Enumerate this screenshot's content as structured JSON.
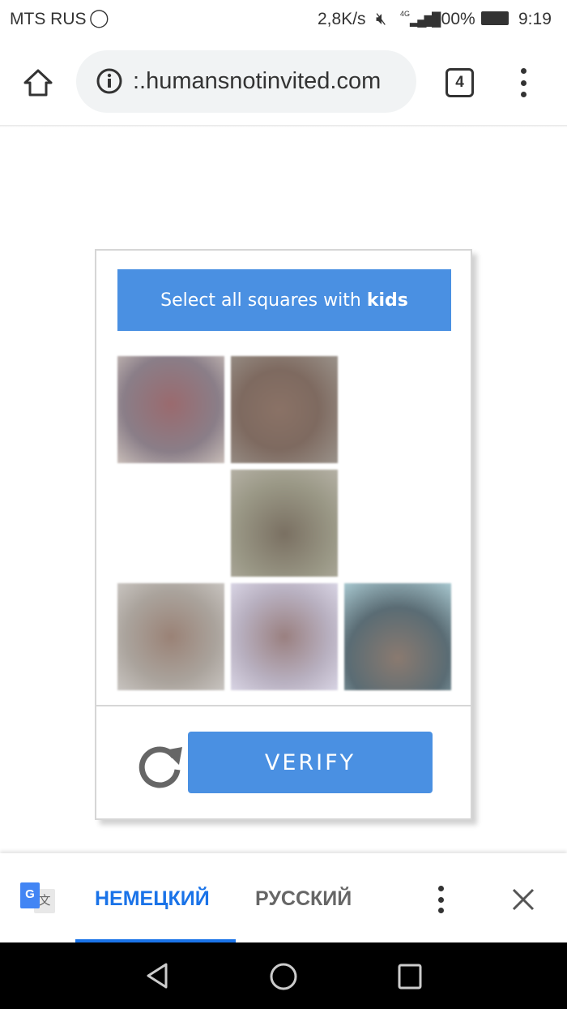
{
  "status_bar": {
    "carrier": "MTS RUS",
    "speed": "2,8K/s",
    "network": "4G",
    "battery": "100%",
    "time": "9:19"
  },
  "browser": {
    "url": ":.humansnotinvited.com",
    "tab_count": "4"
  },
  "captcha": {
    "instruction_prefix": "Select all squares with ",
    "instruction_target": "kids",
    "tiles": [
      {
        "row": 0,
        "col": 0,
        "visible": true
      },
      {
        "row": 0,
        "col": 1,
        "visible": true
      },
      {
        "row": 0,
        "col": 2,
        "visible": false
      },
      {
        "row": 1,
        "col": 0,
        "visible": false
      },
      {
        "row": 1,
        "col": 1,
        "visible": true
      },
      {
        "row": 1,
        "col": 2,
        "visible": false
      },
      {
        "row": 2,
        "col": 0,
        "visible": true
      },
      {
        "row": 2,
        "col": 1,
        "visible": true
      },
      {
        "row": 2,
        "col": 2,
        "visible": true
      }
    ],
    "verify_label": "VERIFY",
    "accent": "#4a90e2"
  },
  "translate_bar": {
    "languages": [
      {
        "label": "НЕМЕЦКИЙ",
        "selected": true
      },
      {
        "label": "РУССКИЙ",
        "selected": false
      }
    ],
    "accent": "#1a73e8"
  }
}
